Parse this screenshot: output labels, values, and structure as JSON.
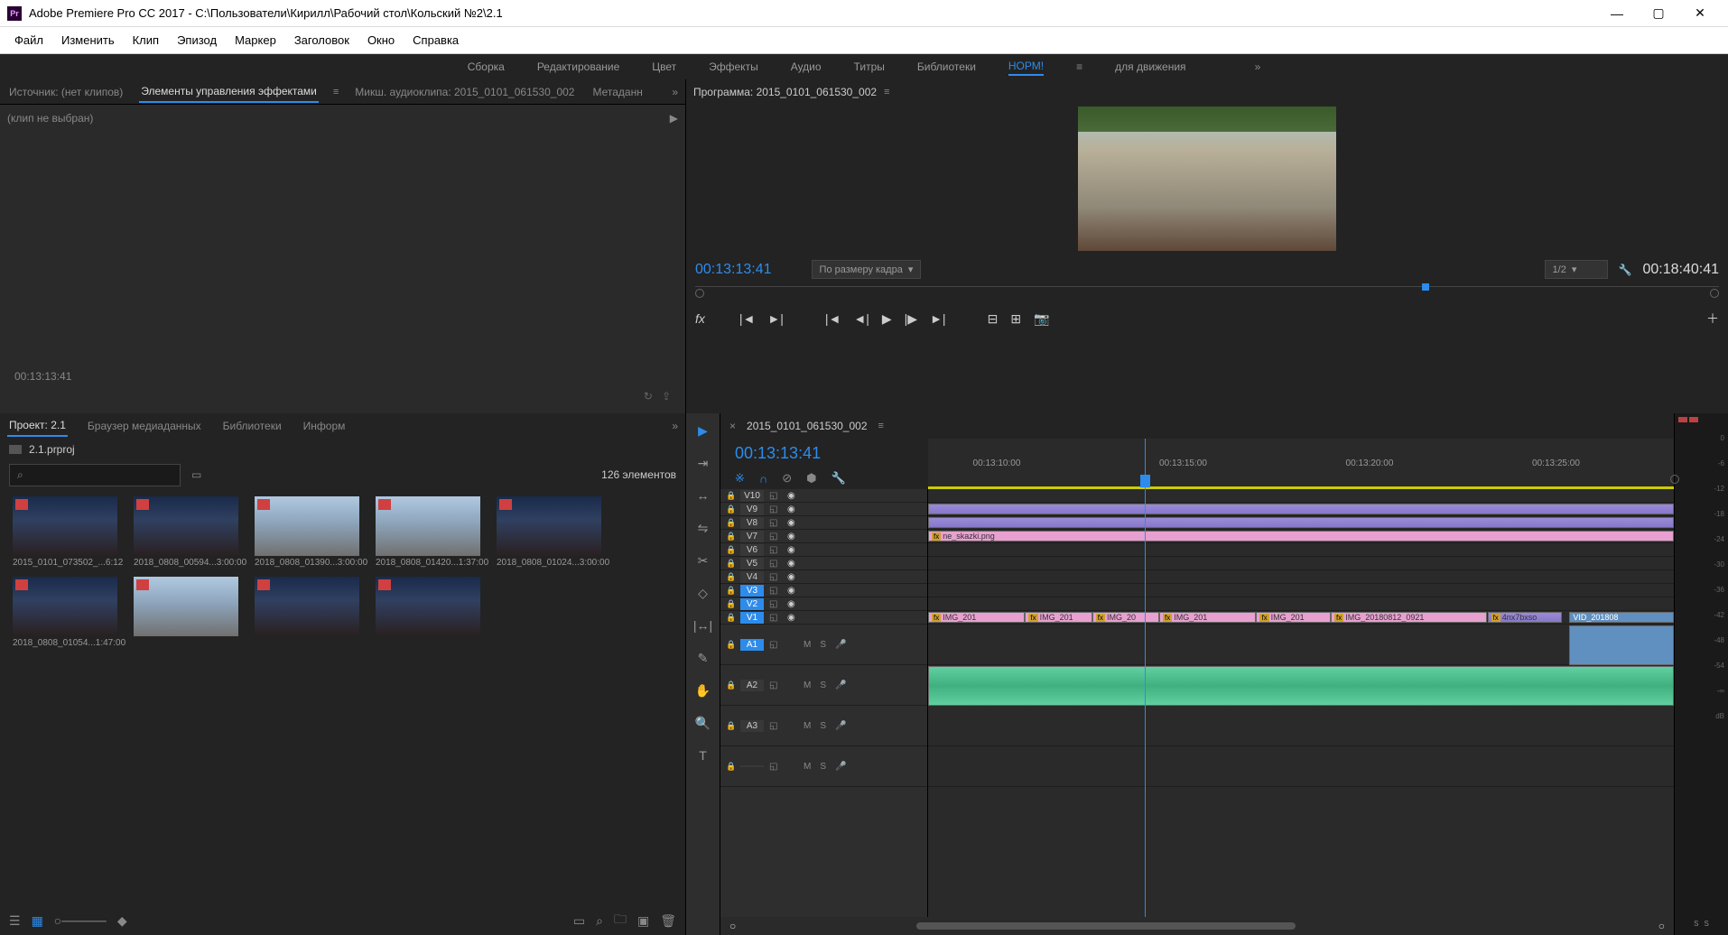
{
  "titlebar": {
    "app_name": "Adobe Premiere Pro CC 2017",
    "path": "C:\\Пользователи\\Кирилл\\Рабочий стол\\Кольский №2\\2.1",
    "icon_text": "Pr"
  },
  "menubar": [
    "Файл",
    "Изменить",
    "Клип",
    "Эпизод",
    "Маркер",
    "Заголовок",
    "Окно",
    "Справка"
  ],
  "workspaces": {
    "items": [
      "Сборка",
      "Редактирование",
      "Цвет",
      "Эффекты",
      "Аудио",
      "Титры",
      "Библиотеки",
      "НОРМ!",
      "для движения"
    ],
    "active": "НОРМ!"
  },
  "source_tabs": {
    "items": [
      "Источник: (нет клипов)",
      "Элементы управления эффектами",
      "Микш. аудиоклипа: 2015_0101_061530_002",
      "Метаданн"
    ],
    "active_index": 1
  },
  "effect_controls": {
    "noclip": "(клип не выбран)",
    "tc": "00:13:13:41"
  },
  "program": {
    "label": "Программа:",
    "sequence": "2015_0101_061530_002",
    "tc_current": "00:13:13:41",
    "fit_label": "По размеру кадра",
    "resolution": "1/2",
    "tc_total": "00:18:40:41"
  },
  "project": {
    "tabs": [
      "Проект: 2.1",
      "Браузер медиаданных",
      "Библиотеки",
      "Информ"
    ],
    "active_tab": 0,
    "filename": "2.1.prproj",
    "item_count": "126 элементов",
    "search_icon": "⌕",
    "thumbs": [
      {
        "name": "2015_0101_073502_...",
        "dur": "6:12",
        "light": false
      },
      {
        "name": "2018_0808_00594...",
        "dur": "3:00:00",
        "light": false
      },
      {
        "name": "2018_0808_01390...",
        "dur": "3:00:00",
        "light": true
      },
      {
        "name": "2018_0808_01420...",
        "dur": "1:37:00",
        "light": true
      },
      {
        "name": "2018_0808_01024...",
        "dur": "3:00:00",
        "light": false
      },
      {
        "name": "2018_0808_01054...",
        "dur": "1:47:00",
        "light": false
      },
      {
        "name": "",
        "dur": "",
        "light": true
      },
      {
        "name": "",
        "dur": "",
        "light": false
      },
      {
        "name": "",
        "dur": "",
        "light": false
      }
    ]
  },
  "timeline": {
    "sequence": "2015_0101_061530_002",
    "tc": "00:13:13:41",
    "ruler_ticks": [
      "00:13:10:00",
      "00:13:15:00",
      "00:13:20:00",
      "00:13:25:00"
    ],
    "video_tracks": [
      "V10",
      "V9",
      "V8",
      "V7",
      "V6",
      "V5",
      "V4",
      "V3",
      "V2",
      "V1"
    ],
    "selected_video": [
      "V3",
      "V2",
      "V1"
    ],
    "audio_tracks": [
      "A1",
      "A2",
      "A3",
      ""
    ],
    "selected_audio": [
      "A1"
    ],
    "audio_ms": {
      "M": "M",
      "S": "S"
    },
    "clips": {
      "ne_skazki": "ne_skazki.png",
      "v1": [
        "IMG_201",
        "IMG_201",
        "IMG_20",
        "IMG_201",
        "IMG_201",
        "IMG_20180812_0921",
        "4nx7bxso",
        "VID_201808"
      ]
    }
  },
  "meter": {
    "ticks": [
      "0",
      "-6",
      "-12",
      "-18",
      "-24",
      "-30",
      "-36",
      "-42",
      "-48",
      "-54",
      "-∞",
      "dB"
    ],
    "footer": [
      "S",
      "S"
    ]
  }
}
